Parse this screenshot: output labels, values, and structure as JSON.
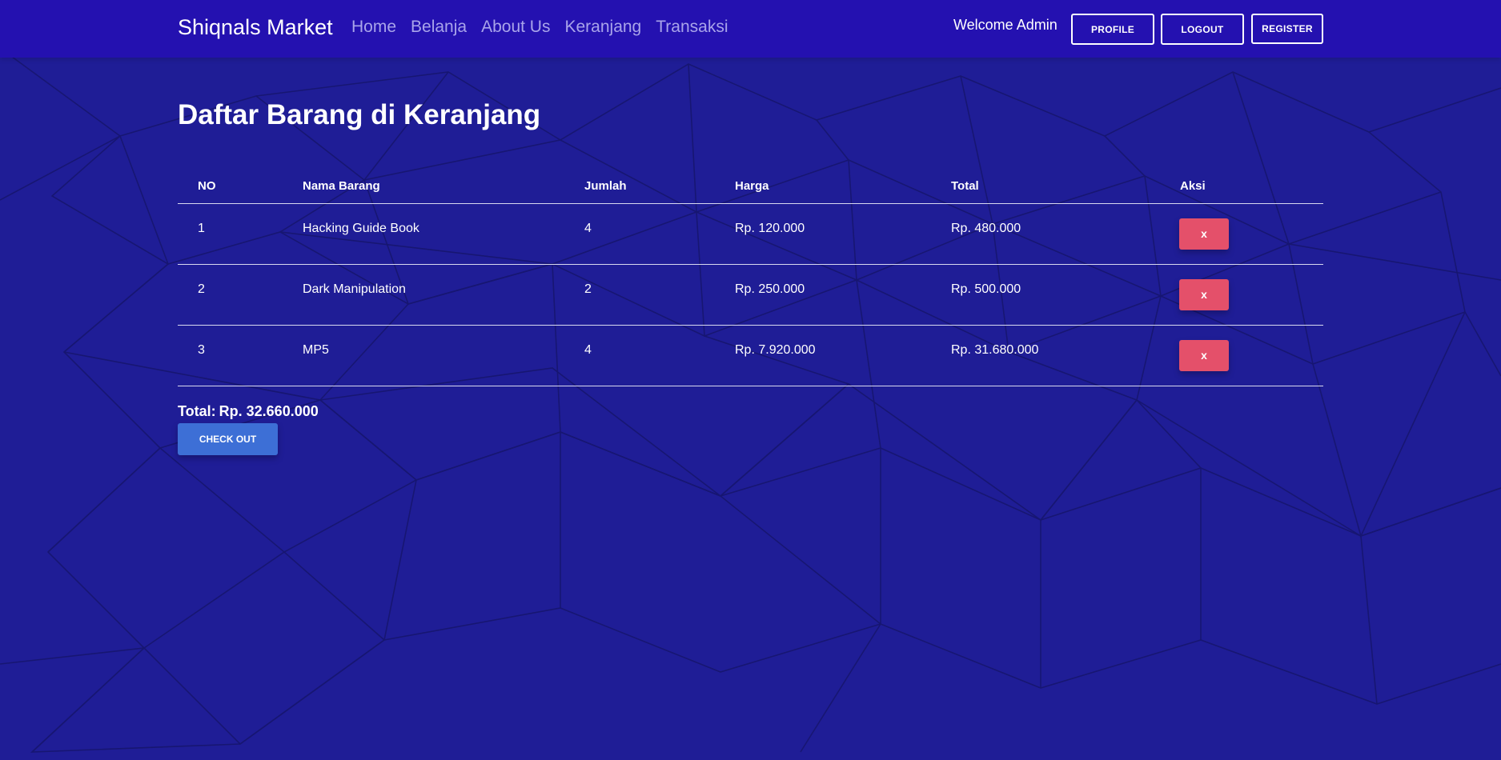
{
  "navbar": {
    "brand": "Shiqnals Market",
    "links": [
      "Home",
      "Belanja",
      "About Us",
      "Keranjang",
      "Transaksi"
    ],
    "welcome_text": "Welcome Admin",
    "profile_label": "PROFILE",
    "logout_label": "LOGOUT",
    "register_label": "REGISTER"
  },
  "page": {
    "title": "Daftar Barang di Keranjang"
  },
  "cart_table": {
    "headers": [
      "NO",
      "Nama Barang",
      "Jumlah",
      "Harga",
      "Total",
      "Aksi"
    ],
    "rows": [
      {
        "no": "1",
        "name": "Hacking Guide Book",
        "qty": "4",
        "price": "Rp. 120.000",
        "total": "Rp. 480.000",
        "action": "x"
      },
      {
        "no": "2",
        "name": "Dark Manipulation",
        "qty": "2",
        "price": "Rp. 250.000",
        "total": "Rp. 500.000",
        "action": "x"
      },
      {
        "no": "3",
        "name": "MP5",
        "qty": "4",
        "price": "Rp. 7.920.000",
        "total": "Rp. 31.680.000",
        "action": "x"
      }
    ]
  },
  "summary": {
    "label": "Total:",
    "amount": "Rp. 32.660.000",
    "checkout_label": "CHECK OUT"
  },
  "colors": {
    "background": "#1f1d96",
    "navbar": "#2411b0",
    "delete_button": "#e4506a",
    "checkout_button": "#3d6fd6"
  }
}
